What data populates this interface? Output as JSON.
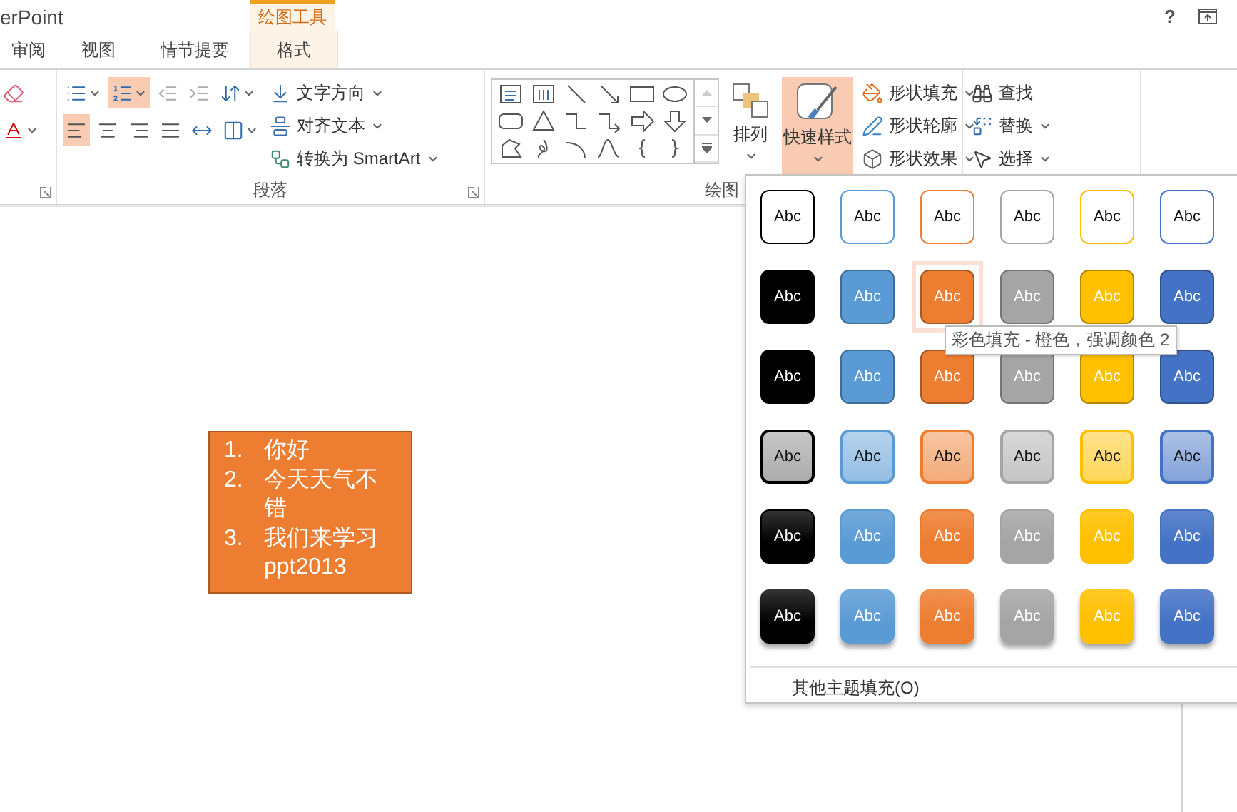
{
  "window": {
    "title": "erPoint",
    "help": "?"
  },
  "context_tab_group": {
    "label": "绘图工具"
  },
  "tabs": [
    {
      "label": "审阅",
      "selected": false
    },
    {
      "label": "视图",
      "selected": false
    },
    {
      "label": "情节提要",
      "selected": false
    },
    {
      "label": "格式",
      "selected": true
    }
  ],
  "ribbon": {
    "font_group": {
      "tools": [
        {
          "kind": "clear-format"
        },
        {
          "kind": "font-color",
          "dropdown": true
        }
      ]
    },
    "paragraph": {
      "label": "段落",
      "row1": [
        {
          "kind": "bullets",
          "selected": false,
          "dropdown": true
        },
        {
          "kind": "numbering",
          "selected": true,
          "dropdown": true
        },
        {
          "kind": "indent-decrease",
          "selected": false,
          "dropdown": false
        },
        {
          "kind": "indent-increase",
          "selected": false,
          "dropdown": false
        },
        {
          "kind": "line-spacing",
          "selected": false,
          "dropdown": true
        }
      ],
      "row2": [
        {
          "kind": "align-left",
          "selected": true,
          "dropdown": false
        },
        {
          "kind": "align-center",
          "selected": false,
          "dropdown": false
        },
        {
          "kind": "align-right",
          "selected": false,
          "dropdown": false
        },
        {
          "kind": "justify",
          "selected": false,
          "dropdown": false
        },
        {
          "kind": "distribute",
          "selected": false,
          "dropdown": false
        },
        {
          "kind": "columns",
          "selected": false,
          "dropdown": true
        }
      ],
      "commands": [
        {
          "kind": "text-direction",
          "label": "文字方向"
        },
        {
          "kind": "align-text",
          "label": "对齐文本"
        },
        {
          "kind": "smartart",
          "label": "转换为 SmartArt"
        }
      ]
    },
    "drawing": {
      "label": "绘图",
      "arrange": {
        "label": "排列"
      },
      "quick_styles": {
        "label": "快速样式",
        "selected": true
      },
      "commands": [
        {
          "kind": "fill",
          "label": "形状填充"
        },
        {
          "kind": "outline",
          "label": "形状轮廓"
        },
        {
          "kind": "effects",
          "label": "形状效果"
        }
      ]
    },
    "editing": {
      "commands": [
        {
          "kind": "find",
          "label": "查找",
          "dropdown": false
        },
        {
          "kind": "replace",
          "label": "替换",
          "dropdown": true
        },
        {
          "kind": "select",
          "label": "选择",
          "dropdown": true
        }
      ]
    }
  },
  "slide": {
    "items": [
      {
        "number": "1.",
        "text": "你好"
      },
      {
        "number": "2.",
        "text": "今天天气不错"
      },
      {
        "number": "3.",
        "text": "我们来学习ppt2013"
      }
    ]
  },
  "style_gallery": {
    "rows": [
      {
        "kind": "outline",
        "swatches": [
          {
            "label": "Abc",
            "color": "#000000",
            "selected": false
          },
          {
            "label": "Abc",
            "color": "#5b9bd5",
            "selected": false
          },
          {
            "label": "Abc",
            "color": "#ed7d31",
            "selected": false
          },
          {
            "label": "Abc",
            "color": "#a5a5a5",
            "selected": false
          },
          {
            "label": "Abc",
            "color": "#ffc000",
            "selected": false
          },
          {
            "label": "Abc",
            "color": "#4472c4",
            "selected": false
          }
        ]
      },
      {
        "kind": "solid",
        "swatches": [
          {
            "label": "Abc",
            "color": "#000000",
            "selected": false
          },
          {
            "label": "Abc",
            "color": "#5b9bd5",
            "selected": false
          },
          {
            "label": "Abc",
            "color": "#ed7d31",
            "selected": true
          },
          {
            "label": "Abc",
            "color": "#a5a5a5",
            "selected": false
          },
          {
            "label": "Abc",
            "color": "#ffc000",
            "selected": false
          },
          {
            "label": "Abc",
            "color": "#4472c4",
            "selected": false
          }
        ]
      },
      {
        "kind": "solid",
        "swatches": [
          {
            "label": "Abc",
            "color": "#000000",
            "selected": false
          },
          {
            "label": "Abc",
            "color": "#5b9bd5",
            "selected": false
          },
          {
            "label": "Abc",
            "color": "#ed7d31",
            "selected": false
          },
          {
            "label": "Abc",
            "color": "#a5a5a5",
            "selected": false
          },
          {
            "label": "Abc",
            "color": "#ffc000",
            "selected": false
          },
          {
            "label": "Abc",
            "color": "#4472c4",
            "selected": false
          }
        ]
      },
      {
        "kind": "light",
        "swatches": [
          {
            "label": "Abc",
            "color": "#000000",
            "selected": false
          },
          {
            "label": "Abc",
            "color": "#5b9bd5",
            "selected": false
          },
          {
            "label": "Abc",
            "color": "#ed7d31",
            "selected": false
          },
          {
            "label": "Abc",
            "color": "#a5a5a5",
            "selected": false
          },
          {
            "label": "Abc",
            "color": "#ffc000",
            "selected": false
          },
          {
            "label": "Abc",
            "color": "#4472c4",
            "selected": false
          }
        ]
      },
      {
        "kind": "gradient",
        "swatches": [
          {
            "label": "Abc",
            "color": "#000000",
            "selected": false
          },
          {
            "label": "Abc",
            "color": "#5b9bd5",
            "selected": false
          },
          {
            "label": "Abc",
            "color": "#ed7d31",
            "selected": false
          },
          {
            "label": "Abc",
            "color": "#a5a5a5",
            "selected": false
          },
          {
            "label": "Abc",
            "color": "#ffc000",
            "selected": false
          },
          {
            "label": "Abc",
            "color": "#4472c4",
            "selected": false
          }
        ]
      },
      {
        "kind": "shadow",
        "swatches": [
          {
            "label": "Abc",
            "color": "#000000",
            "selected": false
          },
          {
            "label": "Abc",
            "color": "#5b9bd5",
            "selected": false
          },
          {
            "label": "Abc",
            "color": "#ed7d31",
            "selected": false
          },
          {
            "label": "Abc",
            "color": "#a5a5a5",
            "selected": false
          },
          {
            "label": "Abc",
            "color": "#ffc000",
            "selected": false
          },
          {
            "label": "Abc",
            "color": "#4472c4",
            "selected": false
          }
        ]
      }
    ],
    "more": "其他主题填充(O)"
  },
  "tooltip": "彩色填充 - 橙色，强调颜色 2"
}
